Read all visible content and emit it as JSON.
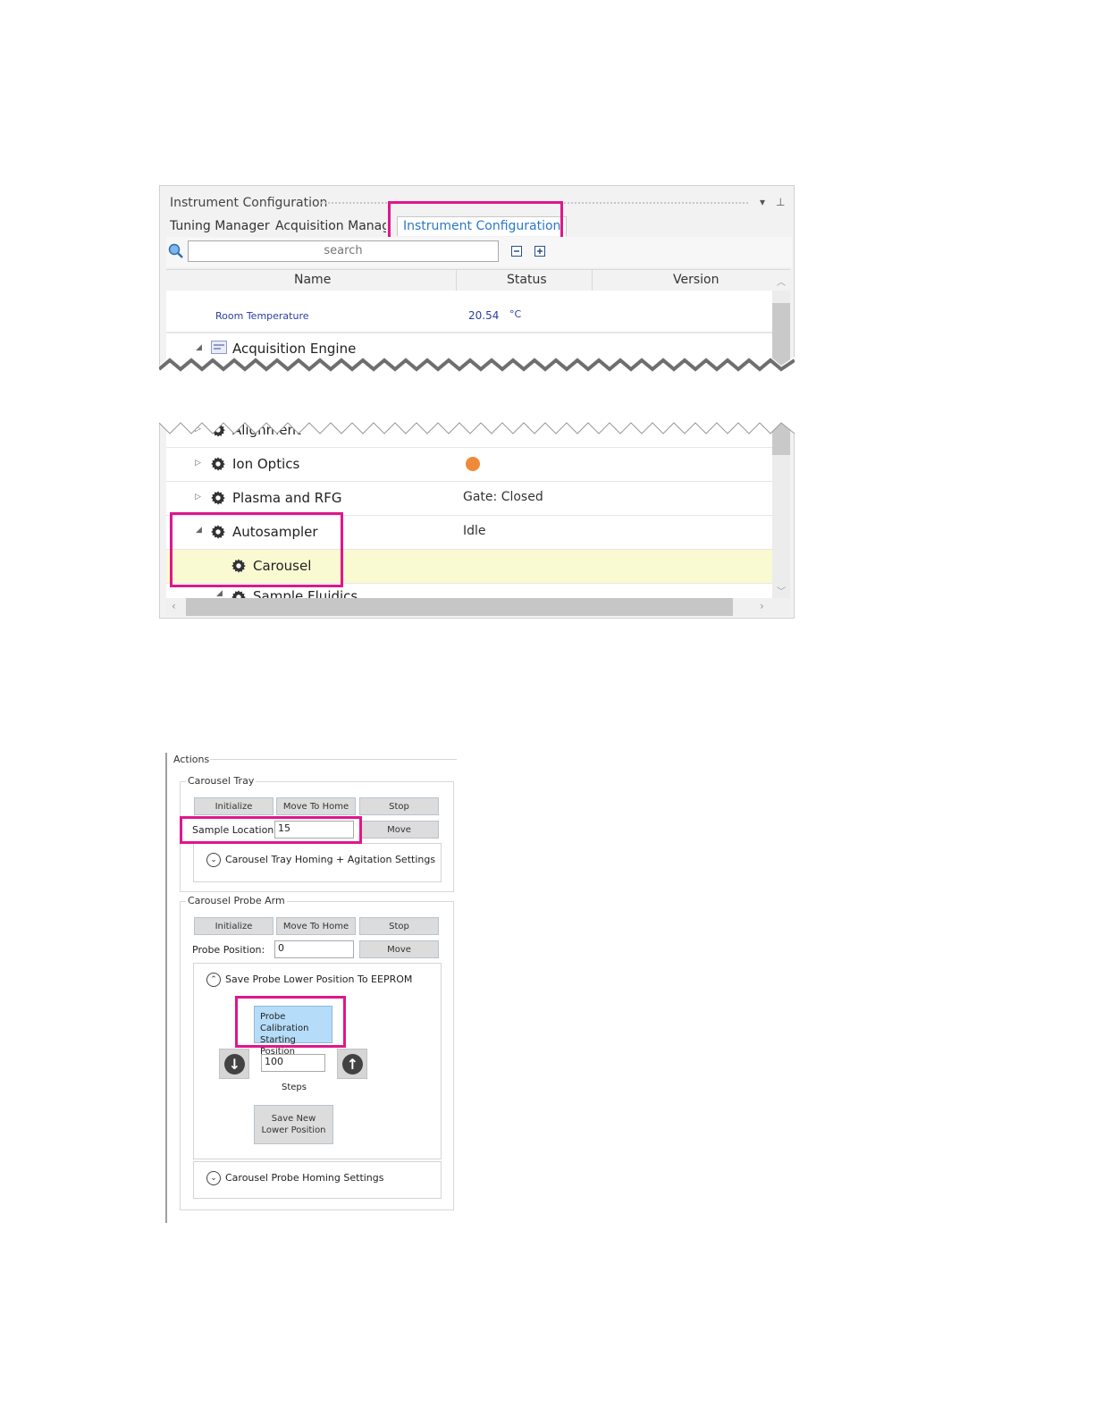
{
  "panel1": {
    "title": "Instrument Configuration",
    "tabs": [
      "Tuning Manager",
      "Acquisition Manager",
      "Instrument Configuration"
    ],
    "active_tab": "Instrument Configuration",
    "search_placeholder": "search",
    "columns": {
      "name": "Name",
      "status": "Status",
      "version": "Version"
    },
    "top_rows": {
      "room_temp_label": "Room Temperature",
      "room_temp_value": "20.54",
      "room_temp_unit": "°C",
      "acq_engine": "Acquisition Engine"
    },
    "bottom_rows": [
      {
        "name": "Alignment",
        "status": ""
      },
      {
        "name": "Ion Optics",
        "status": "",
        "status_dot_color": "#f08a3a"
      },
      {
        "name": "Plasma and RFG",
        "status": "Gate: Closed"
      },
      {
        "name": "Autosampler",
        "status": "Idle"
      },
      {
        "name": "Carousel",
        "status": "",
        "selected": true
      },
      {
        "name": "Sample Fluidics",
        "status": ""
      }
    ],
    "highlight_color": "#e0168c",
    "selected_row_color": "#fafad2"
  },
  "panel2": {
    "title": "Actions",
    "tray": {
      "title": "Carousel Tray",
      "initialize": "Initialize",
      "move_home": "Move To Home",
      "stop": "Stop",
      "sample_location_label": "Sample Location:",
      "sample_location_value": "15",
      "move": "Move",
      "expander": "Carousel Tray Homing + Agitation Settings"
    },
    "probe": {
      "title": "Carousel Probe Arm",
      "initialize": "Initialize",
      "move_home": "Move To Home",
      "stop": "Stop",
      "position_label": "Probe Position:",
      "position_value": "0",
      "move": "Move",
      "expander_open": "Save Probe Lower Position To EEPROM",
      "calib_line1": "Probe Calibration",
      "calib_line2": "Starting Position",
      "steps_value": "100",
      "steps_label": "Steps",
      "save_line1": "Save New",
      "save_line2": "Lower Position",
      "expander_homing": "Carousel Probe Homing Settings"
    }
  }
}
